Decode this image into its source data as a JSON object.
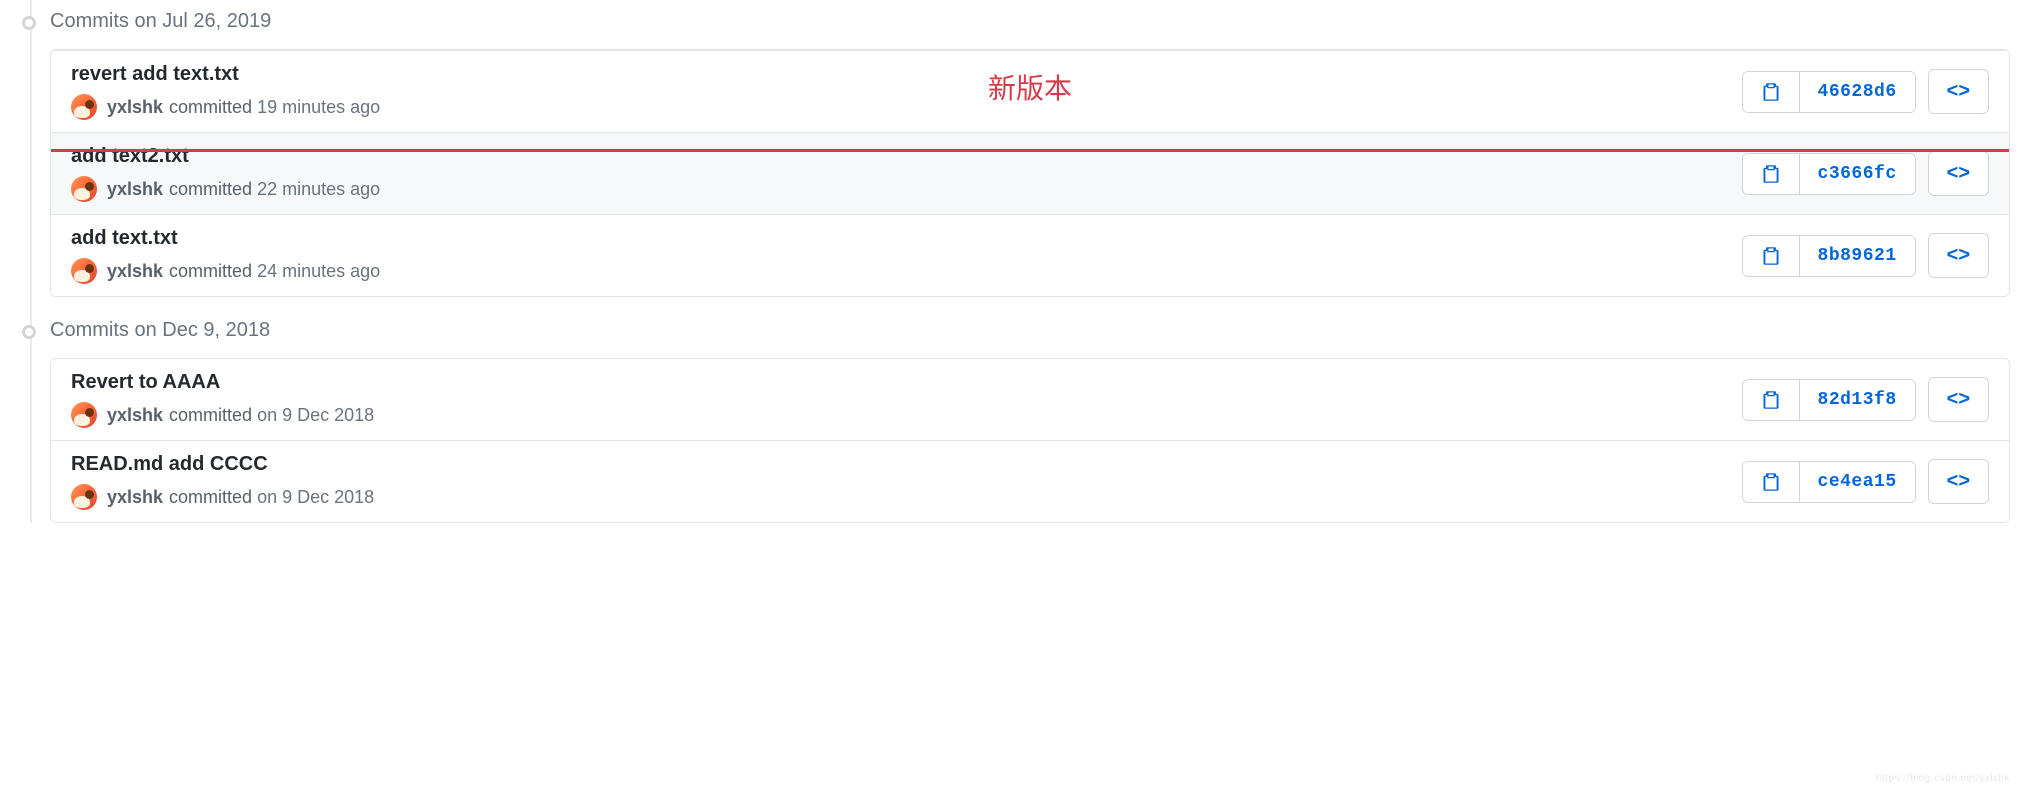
{
  "annotation_text": "新版本",
  "watermark_text": "https://blog.csdn.net/yxlshk",
  "groups": [
    {
      "header": "Commits on Jul 26, 2019",
      "items": [
        {
          "title": "revert add text.txt",
          "author": "yxlshk",
          "committed_label": "committed",
          "time": "19 minutes ago",
          "sha": "46628d6",
          "highlighted": true,
          "annotated": true
        },
        {
          "title": "add text2.txt",
          "author": "yxlshk",
          "committed_label": "committed",
          "time": "22 minutes ago",
          "sha": "c3666fc"
        },
        {
          "title": "add text.txt",
          "author": "yxlshk",
          "committed_label": "committed",
          "time": "24 minutes ago",
          "sha": "8b89621"
        }
      ]
    },
    {
      "header": "Commits on Dec 9, 2018",
      "items": [
        {
          "title": "Revert to AAAA",
          "author": "yxlshk",
          "committed_label": "committed",
          "time": "on 9 Dec 2018",
          "sha": "82d13f8"
        },
        {
          "title": "READ.md add CCCC",
          "author": "yxlshk",
          "committed_label": "committed",
          "time": "on 9 Dec 2018",
          "sha": "ce4ea15"
        }
      ]
    }
  ]
}
